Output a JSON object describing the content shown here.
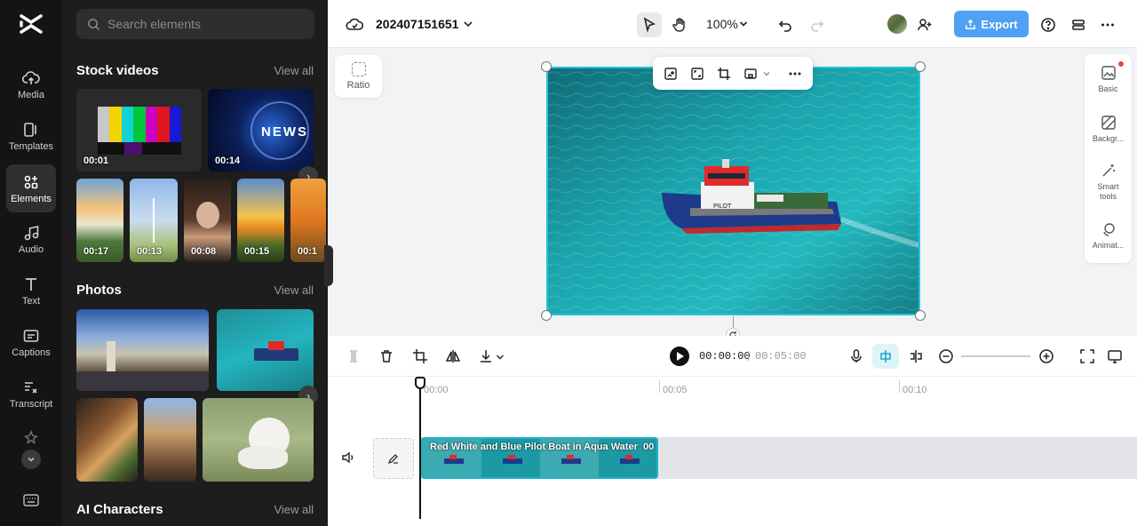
{
  "rail": {
    "items": [
      {
        "label": "Media",
        "icon": "cloud-upload-icon"
      },
      {
        "label": "Templates",
        "icon": "templates-icon"
      },
      {
        "label": "Elements",
        "icon": "elements-icon"
      },
      {
        "label": "Audio",
        "icon": "music-note-icon"
      },
      {
        "label": "Text",
        "icon": "text-icon"
      },
      {
        "label": "Captions",
        "icon": "captions-icon"
      },
      {
        "label": "Transcript",
        "icon": "transcript-icon"
      }
    ]
  },
  "panel": {
    "search_placeholder": "Search elements",
    "stock_videos": {
      "title": "Stock videos",
      "view_all": "View all",
      "durations": [
        "00:01",
        "00:14",
        "00:17",
        "00:13",
        "00:08",
        "00:15",
        "00:1"
      ],
      "news_text": "NEWS"
    },
    "photos": {
      "title": "Photos",
      "view_all": "View all"
    },
    "ai_characters": {
      "title": "AI Characters",
      "view_all": "View all"
    }
  },
  "topbar": {
    "project_name": "202407151651",
    "zoom": "100%",
    "export_label": "Export"
  },
  "canvas": {
    "ratio_label": "Ratio"
  },
  "props": {
    "items": [
      "Basic",
      "Backgr...",
      "Smart tools",
      "Animat..."
    ]
  },
  "timeline": {
    "current_time": "00:00:00",
    "separator": "|",
    "total_time": "00:05:00",
    "ruler": [
      "00:00",
      "00:05",
      "00:10"
    ],
    "clip_title": "Red White and Blue Pilot Boat in Aqua Water",
    "clip_suffix": "00"
  },
  "colors": {
    "accent": "#24c4d6",
    "export_blue": "#4ea1f3",
    "rail_bg": "#141414",
    "panel_bg": "#1d1d1d"
  }
}
